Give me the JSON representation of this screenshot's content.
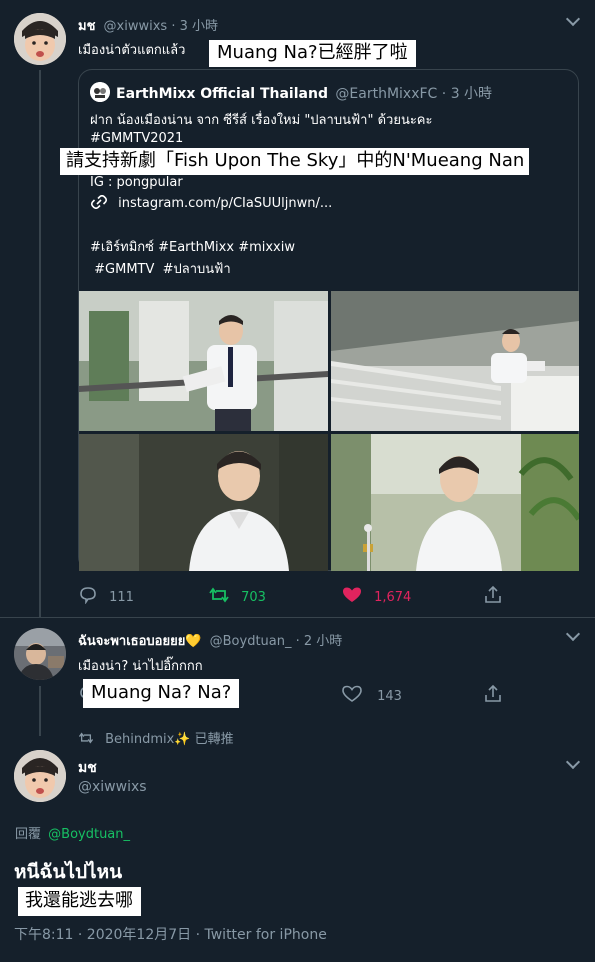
{
  "tweet1": {
    "name": "มช",
    "handle": "@xiwwixs",
    "time": "· 3 小時",
    "text": "เมืองน่าตัวแตกแล้ว",
    "overlay": "Muang Na?已經胖了啦"
  },
  "quote": {
    "name": "EarthMixx Official Thailand",
    "handle": "@EarthMixxFC",
    "time": "· 3 小時",
    "line1": "ฝาก น้องเมืองน่าน จาก ซีรีส์ เรื่องใหม่ \"ปลาบนฟ้า\" ด้วยนะคะ",
    "line2": "#GMMTV2021",
    "overlay": "請支持新劇「Fish Upon The Sky」中的N'Mueang Nan",
    "line4": "IG : pongpular",
    "link": "instagram.com/p/CIaSUUljnwn/...",
    "tags1": "#เอิร์ทมิกซ์ #EarthMixx #mixxiw",
    "tags2": " #GMMTV  #ปลาบนฟ้า"
  },
  "actions1": {
    "replies": "111",
    "retweets": "703",
    "likes": "1,674"
  },
  "tweet2": {
    "name": "ฉันจะพาเธอบอยยย💛",
    "handle": "@Boydtuan_",
    "time": "· 2 小時",
    "text": "เมืองน่า? น่าไปอิ๊กกกก",
    "overlay": "Muang Na? Na?",
    "likes": "143"
  },
  "retweet_note": {
    "text": "Behindmix✨ 已轉推"
  },
  "tweet3": {
    "name": "มช",
    "handle": "@xiwwixs",
    "reply_prefix": "回覆",
    "reply_to": "@Boydtuan_",
    "text": "หนีฉันไปไหน",
    "overlay": "我還能逃去哪",
    "meta": "下午8:11 · 2020年12月7日 · Twitter for iPhone"
  },
  "colors": {
    "background": "#15202b",
    "muted": "#8899a6",
    "retweet_green": "#17bf63",
    "like_red": "#e0245e",
    "link_blue": "#1da1f2",
    "separator": "#38444d"
  }
}
